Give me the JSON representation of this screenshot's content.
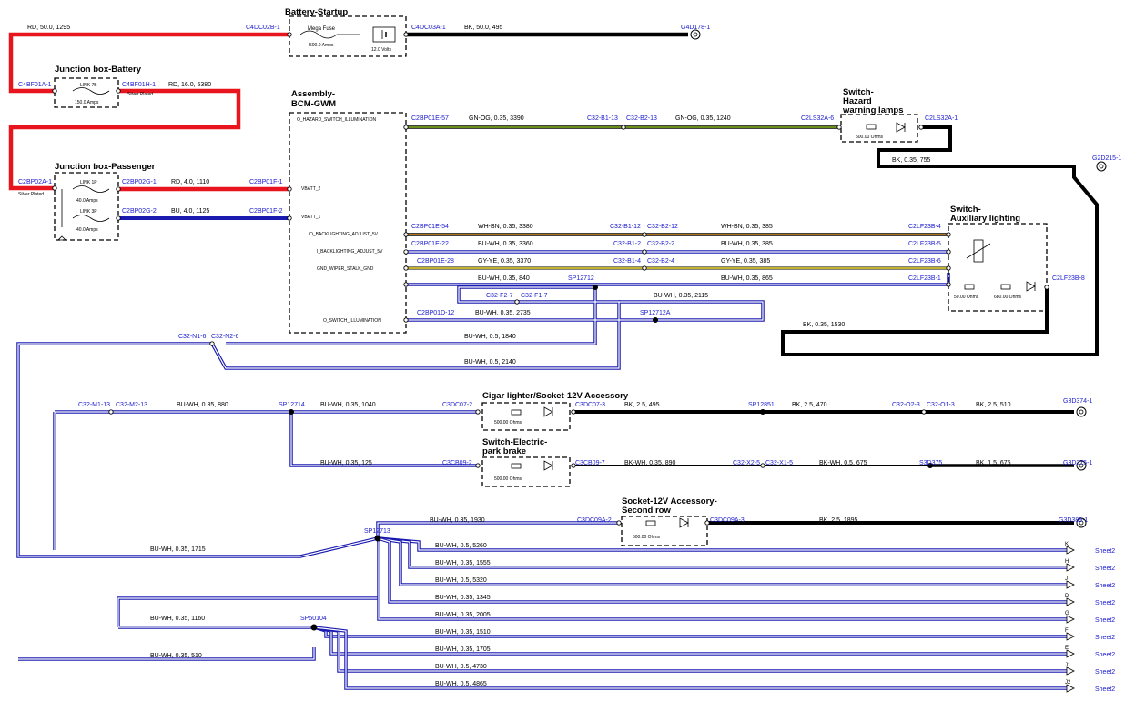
{
  "colors": {
    "red": "#e8141e",
    "blue": "#1a1ab0",
    "black": "#000000",
    "gray": "#555555",
    "green_og": "#7aa21e",
    "yellow": "#e7d21e",
    "orange": "#e89a1e",
    "label_blue": "#1a1ad0",
    "white": "#ffffff"
  },
  "components": {
    "battery_startup": {
      "title": "Battery-Startup",
      "fuse_label": "Mega Fuse",
      "fuse_rating": "500.0 Amps",
      "voltage": "12.0 Volts"
    },
    "jbox_battery": {
      "title": "Junction box-Battery",
      "link": "LINK 7B",
      "rating": "150.0 Amps",
      "note": "Silver Plated"
    },
    "jbox_passenger": {
      "title": "Junction box-Passenger",
      "link1": "LINK 1P",
      "rating1": "40.0 Amps",
      "link2": "LINK 3P",
      "rating2": "40.0 Amps",
      "note": "Silver Plated"
    },
    "bcm": {
      "title1": "Assembly-",
      "title2": "BCM-GWM",
      "pins": [
        "O_HAZARD_SWITCH_ILLUMINATION",
        "VBATT_2",
        "VBATT_1",
        "O_BACKLIGHTING_ADJUST_5V",
        "I_BACKLIGHTING_ADJUST_5V",
        "GND_WIPER_STALK_GND",
        "O_SWITCH_ILLUMINATION"
      ]
    },
    "hazard": {
      "title1": "Switch-",
      "title2": "Hazard",
      "title3": "warning lamps",
      "res": "500.00 Ohms"
    },
    "aux": {
      "title1": "Switch-",
      "title2": "Auxiliary lighting",
      "res1": "50.00 Ohms",
      "res2": "680.00 Ohms"
    },
    "cigar": {
      "title": "Cigar lighter/Socket-12V Accessory",
      "res": "500.00 Ohms"
    },
    "epb": {
      "title1": "Switch-Electric-",
      "title2": "park brake",
      "res": "500.00 Ohms"
    },
    "socket2": {
      "title1": "Socket-12V Accessory-",
      "title2": "Second row",
      "res": "500.00 Ohms"
    }
  },
  "connectors": {
    "C4DC02B_1": "C4DC02B-1",
    "C4DC03A_1": "C4DC03A-1",
    "G4D178_1": "G4D178-1",
    "C4BF01A_1": "C4BF01A-1",
    "C4BF01H_1": "C4BF01H-1",
    "C2BP02A_1": "C2BP02A-1",
    "C2BP02G_1": "C2BP02G-1",
    "C2BP02G_2": "C2BP02G-2",
    "C2BP01F_1": "C2BP01F-1",
    "C2BP01F_2": "C2BP01F-2",
    "C2BP01E_57": "C2BP01E-57",
    "C32_B1_13": "C32-B1-13",
    "C32_B2_13": "C32-B2-13",
    "C2LS32A_6": "C2LS32A-6",
    "C2LS32A_1": "C2LS32A-1",
    "G2D215_1": "G2D215-1",
    "C2BP01E_54": "C2BP01E-54",
    "C32_B1_12": "C32-B1-12",
    "C32_B2_12": "C32-B2-12",
    "C2LF23B_4": "C2LF23B-4",
    "C2BP01E_22": "C2BP01E-22",
    "C32_B1_2": "C32-B1-2",
    "C32_B2_2": "C32-B2-2",
    "C2LF23B_5": "C2LF23B-5",
    "C2BP01E_28": "C2BP01E-28",
    "C32_B1_4": "C32-B1-4",
    "C32_B2_4": "C32-B2-4",
    "C2LF23B_6": "C2LF23B-6",
    "SP12712": "SP12712",
    "C2LF23B_1": "C2LF23B-1",
    "C2LF23B_8": "C2LF23B-8",
    "C32_F2_7": "C32-F2-7",
    "C32_F1_7": "C32-F1-7",
    "C2BP01D_12": "C2BP01D-12",
    "SP12712A": "SP12712A",
    "C32_N1_6": "C32-N1-6",
    "C32_N2_6": "C32-N2-6",
    "C32_M1_13": "C32-M1-13",
    "C32_M2_13": "C32-M2-13",
    "SP12714": "SP12714",
    "C3DC07_2": "C3DC07-2",
    "C3DC07_3": "C3DC07-3",
    "SP12851": "SP12851",
    "C32_O2_3": "C32-O2-3",
    "C32_O1_3": "C32-O1-3",
    "G3D374_1": "G3D374-1",
    "C3CB09_2": "C3CB09-2",
    "C3CB09_7": "C3CB09-7",
    "C32_X2_5": "C32-X2-5",
    "C32_X1_5": "C32-X1-5",
    "S3D375": "S3D375",
    "G3D375_1": "G3D375-1",
    "SP12713": "SP12713",
    "C3DC09A_2": "C3DC09A-2",
    "C3DC09A_3": "C3DC09A-3",
    "G3D389_1": "G3D389-1",
    "SP50104": "SP50104"
  },
  "wires": {
    "w1": "RD,  50.0,  1295",
    "w2": "BK,  50.0,  495",
    "w3": "RD,  16.0,  5380",
    "w4": "RD,  4.0,  1110",
    "w5": "BU,  4.0,  1125",
    "w6": "GN-OG,  0.35,  3390",
    "w7": "GN-OG,  0.35,  1240",
    "w8": "BK,  0.35,  755",
    "w9": "WH-BN,  0.35,  3380",
    "w10": "WH-BN,  0.35,  385",
    "w11": "BU-WH,  0.35,  3360",
    "w12": "BU-WH,  0.35,  385",
    "w13": "GY-YE,  0.35,  3370",
    "w14": "GY-YE,  0.35,  385",
    "w15": "BU-WH,  0.35,  840",
    "w16": "BU-WH,  0.35,  865",
    "w17": "BU-WH,  0.35,  2115",
    "w18": "BU-WH,  0.35,  2735",
    "w19": "BK,  0.35,  1530",
    "w20": "BU-WH,  0.5,  1840",
    "w21": "BU-WH,  0.5,  2140",
    "w22": "BU-WH,  0.35,  880",
    "w23": "BU-WH,  0.35,  1040",
    "w24": "BK,  2.5,  495",
    "w25": "BK,  2.5,  470",
    "w26": "BK,  2.5,  510",
    "w27": "BU-WH,  0.35,  125",
    "w28": "BK-WH,  0.35,  890",
    "w29": "BK-WH,  0.5,  675",
    "w30": "BK,  1.5,  675",
    "w31": "BU-WH,  0.35,  1930",
    "w32": "BK,  2.5,  1895",
    "w33": "BU-WH,  0.35,  1715",
    "w34": "BU-WH,  0.35,  1160",
    "w35": "BU-WH,  0.35,  510"
  },
  "sheet_rows": [
    {
      "wire": "BU-WH,  0.5,  5260",
      "letter": "K",
      "ref": "Sheet2"
    },
    {
      "wire": "BU-WH,  0.35,  1555",
      "letter": "H",
      "ref": "Sheet2"
    },
    {
      "wire": "BU-WH,  0.5,  5320",
      "letter": "J",
      "ref": "Sheet2"
    },
    {
      "wire": "BU-WH,  0.35,  1345",
      "letter": "D",
      "ref": "Sheet2"
    },
    {
      "wire": "BU-WH,  0.35,  2005",
      "letter": "G",
      "ref": "Sheet2"
    },
    {
      "wire": "BU-WH,  0.35,  1510",
      "letter": "F",
      "ref": "Sheet2"
    },
    {
      "wire": "BU-WH,  0.35,  1705",
      "letter": "E",
      "ref": "Sheet2"
    },
    {
      "wire": "BU-WH,  0.5,  4730",
      "letter": "J1",
      "ref": "Sheet2"
    },
    {
      "wire": "BU-WH,  0.5,  4865",
      "letter": "J2",
      "ref": "Sheet2"
    }
  ]
}
